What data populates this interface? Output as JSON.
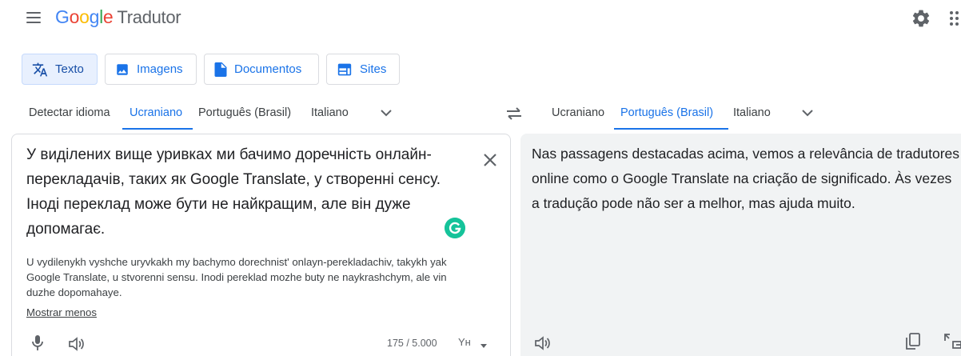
{
  "header": {
    "logo_letters": [
      "G",
      "o",
      "o",
      "g",
      "l",
      "e"
    ],
    "product_name": "Tradutor",
    "icons": [
      "menu-icon",
      "settings-icon",
      "apps-icon"
    ]
  },
  "modes": [
    {
      "label": "Texto",
      "icon": "translate-icon",
      "active": true
    },
    {
      "label": "Imagens",
      "icon": "image-icon",
      "active": false
    },
    {
      "label": "Documentos",
      "icon": "document-icon",
      "active": false
    },
    {
      "label": "Sites",
      "icon": "web-icon",
      "active": false
    }
  ],
  "source_langs": {
    "detect": "Detectar idioma",
    "items": [
      "Ucraniano",
      "Português (Brasil)",
      "Italiano"
    ],
    "selected": "Ucraniano"
  },
  "target_langs": {
    "items": [
      "Ucraniano",
      "Português (Brasil)",
      "Italiano"
    ],
    "selected": "Português (Brasil)"
  },
  "source": {
    "text": "У виділених вище уривках ми бачимо доречність онлайн-перекладачів, таких як Google Translate, у створенні сенсу. Іноді переклад може бути не найкращим, але він дуже допомагає.",
    "transliteration": "U vydilenykh vyshche uryvkakh my bachymo dorechnist' onlayn-perekladachiv, takykh yak Google Translate, u stvorenni sensu. Inodi pereklad mozhe buty ne naykrashchym, ale vin duzhe dopomahaye.",
    "show_less": "Mostrar menos",
    "char_count": "175 / 5.000",
    "keyboard_label": "Yн"
  },
  "target": {
    "text": "Nas passagens destacadas acima, vemos a relevância de tradutores online como o Google Translate na criação de significado. Às vezes a tradução pode não ser a melhor, mas ajuda muito."
  },
  "colors": {
    "accent": "#1a73e8",
    "active_mode_bg": "#e8f0fe",
    "target_panel_bg": "#f1f3f4",
    "grammarly": "#15c39a"
  }
}
